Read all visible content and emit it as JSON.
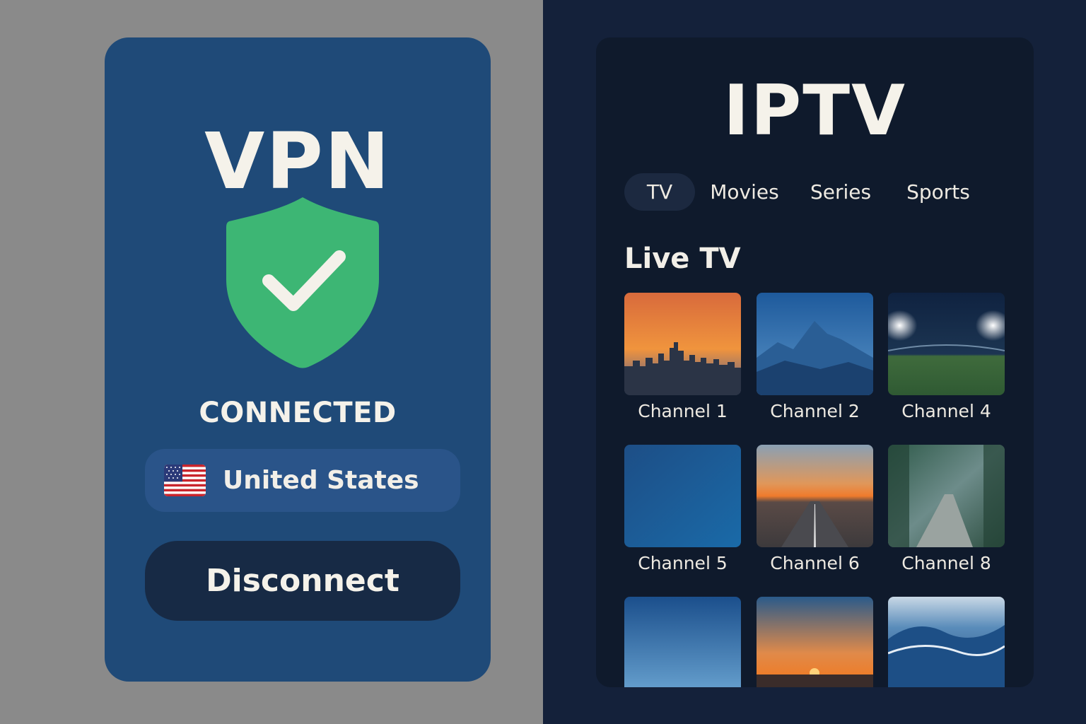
{
  "vpn": {
    "title": "VPN",
    "status": "CONNECTED",
    "country": "United States",
    "disconnect_label": "Disconnect",
    "colors": {
      "card": "#1f4a78",
      "shield": "#3db674",
      "button": "#172a45"
    }
  },
  "iptv": {
    "title": "IPTV",
    "tabs": [
      {
        "label": "TV",
        "active": true
      },
      {
        "label": "Movies"
      },
      {
        "label": "Series"
      },
      {
        "label": "Sports"
      }
    ],
    "section_title": "Live TV",
    "channels": [
      {
        "label": "Channel 1",
        "thumb": "city-skyline-sunset"
      },
      {
        "label": "Channel 2",
        "thumb": "blue-mountains"
      },
      {
        "label": "Channel 4",
        "thumb": "stadium-lights"
      },
      {
        "label": "Channel 5",
        "thumb": "plain-blue"
      },
      {
        "label": "Channel 6",
        "thumb": "road-sunset"
      },
      {
        "label": "Channel 8",
        "thumb": "forest-path"
      },
      {
        "thumb": "blue-sky"
      },
      {
        "thumb": "horizon-sunset"
      },
      {
        "thumb": "ocean-wave"
      }
    ]
  }
}
